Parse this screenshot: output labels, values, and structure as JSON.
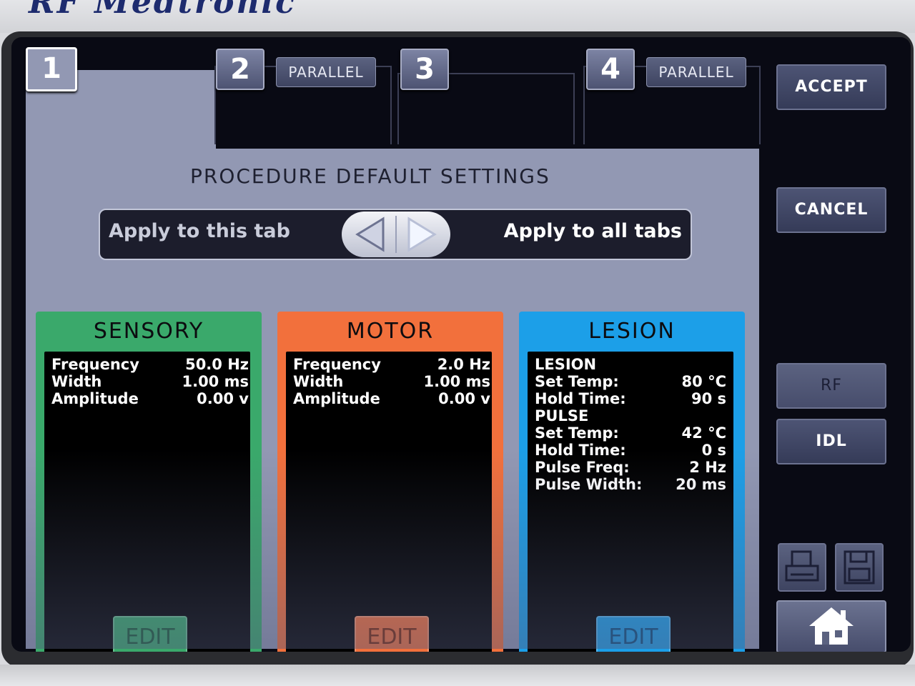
{
  "brand": {
    "text": "RF Medtronic"
  },
  "tabs": [
    {
      "number": "1",
      "active": true
    },
    {
      "number": "2",
      "active": false,
      "parallel_label": "PARALLEL"
    },
    {
      "number": "3",
      "active": false
    },
    {
      "number": "4",
      "active": false,
      "parallel_label": "PARALLEL"
    }
  ],
  "header": {
    "title": "PROCEDURE DEFAULT SETTINGS",
    "apply_this_tab": "Apply to this tab",
    "apply_all_tabs": "Apply to all tabs"
  },
  "cards": {
    "sensory": {
      "title": "SENSORY",
      "color": "#3aa96b",
      "params": [
        {
          "label": "Frequency",
          "value": "50.0 Hz"
        },
        {
          "label": "Width",
          "value": "1.00 ms"
        },
        {
          "label": "Amplitude",
          "value": "0.00 v"
        }
      ],
      "edit_label": "EDIT"
    },
    "motor": {
      "title": "MOTOR",
      "color": "#f2703c",
      "params": [
        {
          "label": "Frequency",
          "value": "2.0 Hz"
        },
        {
          "label": "Width",
          "value": "1.00 ms"
        },
        {
          "label": "Amplitude",
          "value": "0.00 v"
        }
      ],
      "edit_label": "EDIT"
    },
    "lesion": {
      "title": "LESION",
      "color": "#1c9fe8",
      "params": [
        {
          "label": "LESION",
          "value": ""
        },
        {
          "label": "Set Temp:",
          "value": "80 °C"
        },
        {
          "label": "Hold Time:",
          "value": "90 s"
        },
        {
          "label": "PULSE",
          "value": ""
        },
        {
          "label": "Set Temp:",
          "value": "42 °C"
        },
        {
          "label": "Hold Time:",
          "value": "0 s"
        },
        {
          "label": "Pulse Freq:",
          "value": "2 Hz"
        },
        {
          "label": "Pulse Width:",
          "value": "20 ms"
        }
      ],
      "edit_label": "EDIT"
    }
  },
  "sidebar": {
    "accept_label": "ACCEPT",
    "cancel_label": "CANCEL",
    "rf_label": "RF",
    "idl_label": "IDL",
    "print_icon": "printer-icon",
    "save_icon": "floppy-disk-icon",
    "home_icon": "home-icon"
  }
}
